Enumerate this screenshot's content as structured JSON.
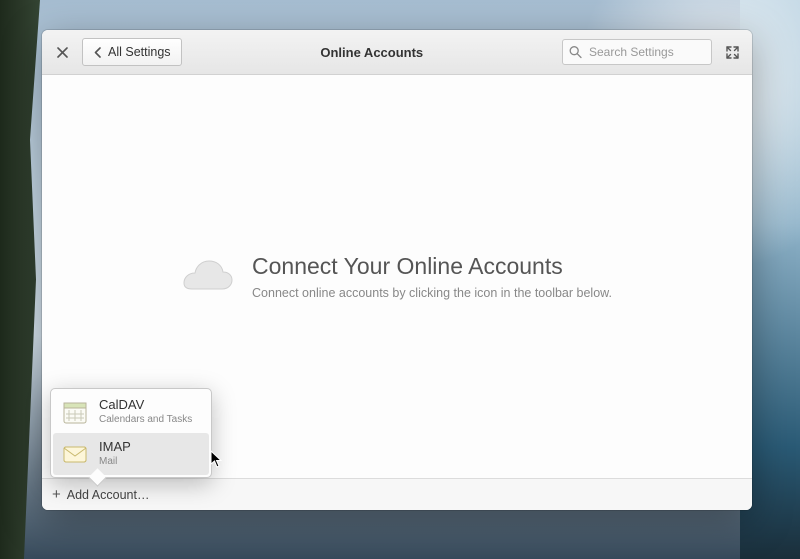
{
  "header": {
    "back_label": "All Settings",
    "title": "Online Accounts",
    "search_placeholder": "Search Settings"
  },
  "empty_state": {
    "heading": "Connect Your Online Accounts",
    "subtext": "Connect online accounts by clicking the icon in the toolbar below."
  },
  "popover": {
    "items": [
      {
        "label": "CalDAV",
        "sub": "Calendars and Tasks",
        "icon": "calendar-icon"
      },
      {
        "label": "IMAP",
        "sub": "Mail",
        "icon": "mail-icon"
      }
    ]
  },
  "toolbar": {
    "add_label": "Add Account…"
  }
}
